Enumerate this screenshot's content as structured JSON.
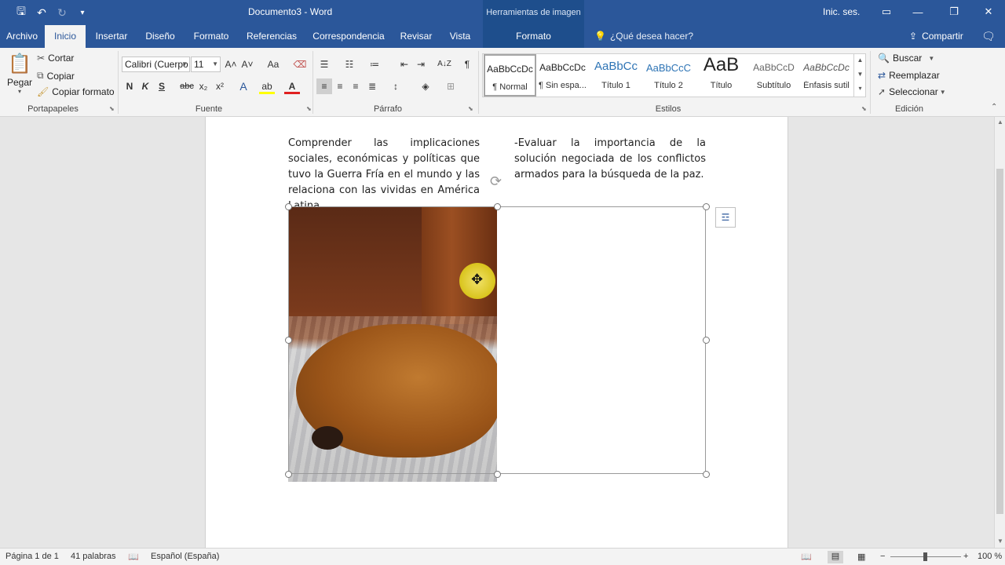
{
  "titlebar": {
    "doc_title": "Documento3 - Word",
    "context_tool": "Herramientas de imagen",
    "signin": "Inic. ses.",
    "icons": [
      "save-icon",
      "undo-icon",
      "redo-icon",
      "customize-qat-icon",
      "ribbon-display-icon",
      "minimize-icon",
      "restore-icon",
      "close-icon"
    ]
  },
  "tabs": {
    "archivo": "Archivo",
    "inicio": "Inicio",
    "insertar": "Insertar",
    "diseno": "Diseño",
    "formato": "Formato",
    "referencias": "Referencias",
    "correspondencia": "Correspondencia",
    "revisar": "Revisar",
    "vista": "Vista",
    "formato_imagen": "Formato",
    "tellme": "¿Qué desea hacer?",
    "share": "Compartir"
  },
  "ribbon": {
    "clipboard": {
      "label": "Portapapeles",
      "paste": "Pegar",
      "cut": "Cortar",
      "copy": "Copiar",
      "format_painter": "Copiar formato"
    },
    "font": {
      "label": "Fuente",
      "family": "Calibri (Cuerpo",
      "size": "11",
      "bold": "N",
      "italic": "K",
      "underline": "S",
      "strike": "abc",
      "subscript": "x₂",
      "superscript": "x²",
      "grow": "A˄",
      "shrink": "A˅",
      "case": "Aa",
      "font_color": "A",
      "highlight": "ab",
      "effects": "A"
    },
    "paragraph": {
      "label": "Párrafo",
      "show_marks": "¶",
      "sort": "A↓Z"
    },
    "styles": {
      "label": "Estilos",
      "items": [
        {
          "preview": "AaBbCcDc",
          "name": "¶ Normal"
        },
        {
          "preview": "AaBbCcDc",
          "name": "¶ Sin espa..."
        },
        {
          "preview": "AaBbCc",
          "name": "Título 1"
        },
        {
          "preview": "AaBbCcC",
          "name": "Título 2"
        },
        {
          "preview": "AaB",
          "name": "Título"
        },
        {
          "preview": "AaBbCcD",
          "name": "Subtítulo"
        },
        {
          "preview": "AaBbCcDc",
          "name": "Énfasis sutil"
        }
      ]
    },
    "editing": {
      "label": "Edición",
      "find": "Buscar",
      "replace": "Reemplazar",
      "select": "Seleccionar"
    }
  },
  "document": {
    "col1": "Comprender las implicaciones sociales, económicas y políticas que tuvo la Guerra Fría en el mundo y las relaciona con las vividas en América Latina.",
    "col2": "-Evaluar la importancia de la solución negociada de los conflictos armados para la búsqueda de la paz."
  },
  "statusbar": {
    "page": "Página 1 de 1",
    "words": "41 palabras",
    "language": "Español (España)",
    "zoom": "100 %",
    "zoom_minus": "−",
    "zoom_plus": "+"
  }
}
